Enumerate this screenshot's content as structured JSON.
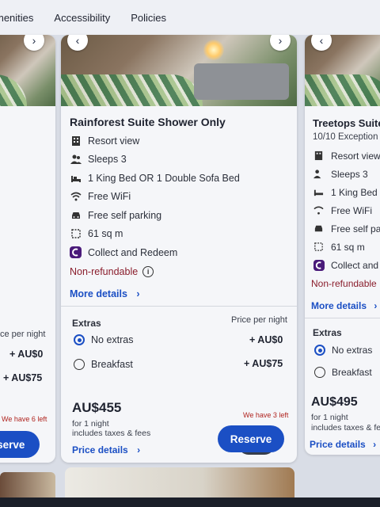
{
  "nav": {
    "items": [
      "menities",
      "Accessibility",
      "Policies"
    ]
  },
  "left_card": {
    "photo_count": "6",
    "extras_price_header": "ce per night",
    "extra_prices": [
      "+ AU$0",
      "+ AU$75"
    ],
    "availability": "We have 6 left",
    "reserve_label": "eserve"
  },
  "center_card": {
    "photo_count": "6",
    "title": "Rainforest Suite Shower Only",
    "features": [
      {
        "icon": "building-icon",
        "label": "Resort view"
      },
      {
        "icon": "people-icon",
        "label": "Sleeps 3"
      },
      {
        "icon": "bed-icon",
        "label": "1 King Bed OR 1 Double Sofa Bed"
      },
      {
        "icon": "wifi-icon",
        "label": "Free WiFi"
      },
      {
        "icon": "car-icon",
        "label": "Free self parking"
      },
      {
        "icon": "area-icon",
        "label": "61 sq m"
      },
      {
        "icon": "rewards-icon",
        "label": "Collect and Redeem"
      }
    ],
    "refund_policy": "Non-refundable",
    "more_details": "More details",
    "extras_heading": "Extras",
    "price_per_night": "Price per night",
    "extras": [
      {
        "label": "No extras",
        "price": "+ AU$0",
        "selected": true
      },
      {
        "label": "Breakfast",
        "price": "+ AU$75",
        "selected": false
      }
    ],
    "price": "AU$455",
    "price_note_1": "for 1 night",
    "price_note_2": "includes taxes & fees",
    "availability": "We have 3 left",
    "reserve_label": "Reserve",
    "price_details": "Price details"
  },
  "right_card": {
    "title": "Treetops Suite",
    "subtitle": "10/10 Exception",
    "features": [
      {
        "icon": "building-icon",
        "label": "Resort view"
      },
      {
        "icon": "people-icon",
        "label": "Sleeps 3"
      },
      {
        "icon": "bed-icon",
        "label": "1 King Bed a"
      },
      {
        "icon": "wifi-icon",
        "label": "Free WiFi"
      },
      {
        "icon": "car-icon",
        "label": "Free self par"
      },
      {
        "icon": "area-icon",
        "label": "61 sq m"
      },
      {
        "icon": "rewards-icon",
        "label": "Collect and"
      }
    ],
    "refund_policy": "Non-refundable",
    "more_details": "More details",
    "extras_heading": "Extras",
    "extras": [
      {
        "label": "No extras",
        "selected": true
      },
      {
        "label": "Breakfast",
        "selected": false
      }
    ],
    "price": "AU$495",
    "price_note_1": "for 1 night",
    "price_note_2": "includes taxes & fees",
    "price_details": "Price details"
  },
  "colors": {
    "accent": "#1b4fc4",
    "nonrefundable": "#8a1d2c",
    "availability": "#b0241f"
  }
}
